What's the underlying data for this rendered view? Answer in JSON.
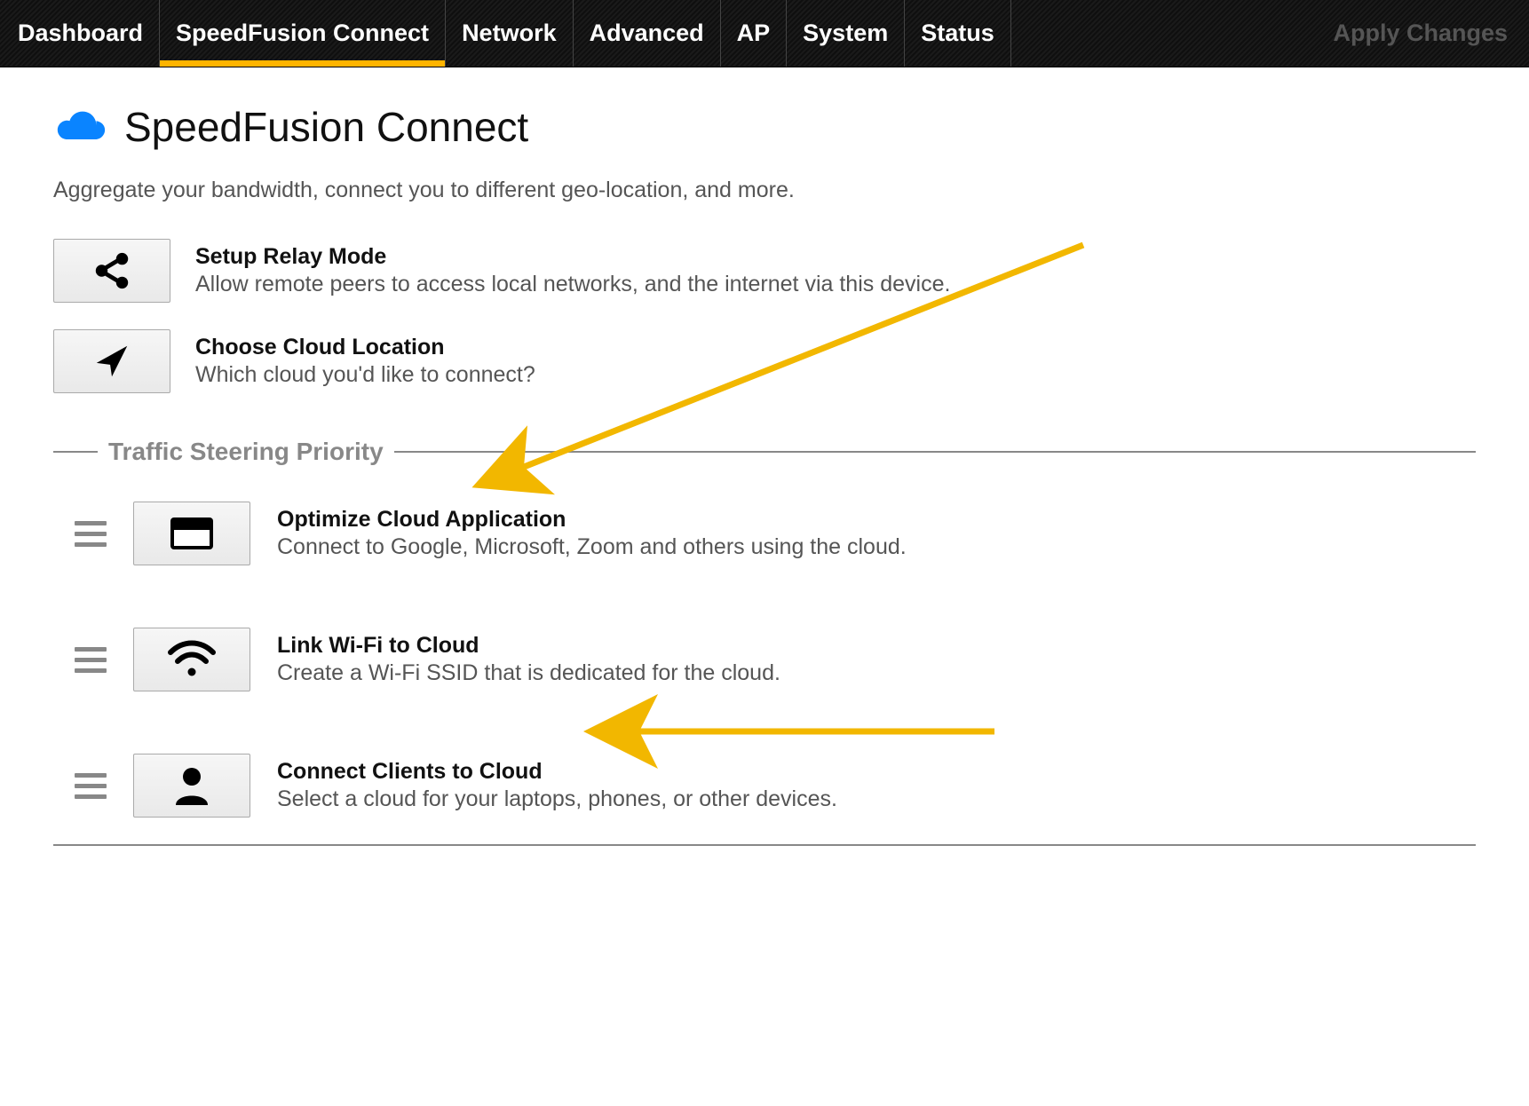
{
  "nav": {
    "items": [
      "Dashboard",
      "SpeedFusion Connect",
      "Network",
      "Advanced",
      "AP",
      "System",
      "Status"
    ],
    "activeIndex": 1,
    "apply": "Apply Changes"
  },
  "page": {
    "title": "SpeedFusion Connect",
    "subtitle": "Aggregate your bandwidth, connect you to different geo-location, and more."
  },
  "cards": [
    {
      "iconName": "share-icon",
      "title": "Setup Relay Mode",
      "desc": "Allow remote peers to access local networks, and the internet via this device."
    },
    {
      "iconName": "location-arrow-icon",
      "title": "Choose Cloud Location",
      "desc": "Which cloud you'd like to connect?"
    }
  ],
  "section": {
    "title": "Traffic Steering Priority"
  },
  "priority": [
    {
      "iconName": "window-icon",
      "title": "Optimize Cloud Application",
      "desc": "Connect to Google, Microsoft, Zoom and others using the cloud."
    },
    {
      "iconName": "wifi-icon",
      "title": "Link Wi-Fi to Cloud",
      "desc": "Create a Wi-Fi SSID that is dedicated for the cloud."
    },
    {
      "iconName": "user-icon",
      "title": "Connect Clients to Cloud",
      "desc": "Select a cloud for your laptops, phones, or other devices."
    }
  ]
}
